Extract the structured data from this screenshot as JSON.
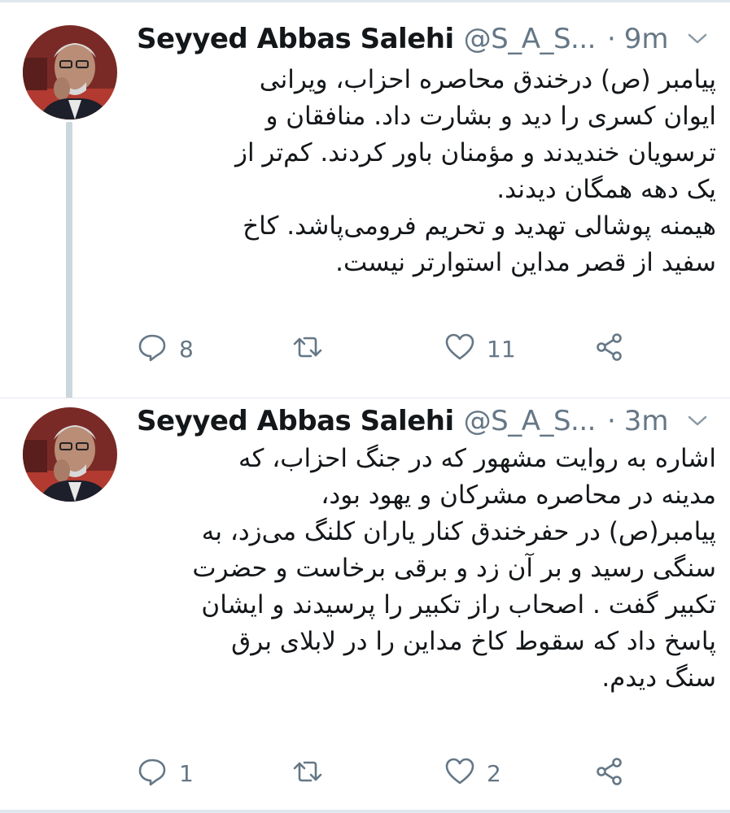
{
  "colors": {
    "text": "#14171a",
    "secondary": "#657786",
    "thread_line": "#ccd6dd",
    "divider": "#e1e8ed"
  },
  "icons": {
    "reply": "reply-icon",
    "retweet": "retweet-icon",
    "like": "heart-icon",
    "share": "share-icon",
    "caret": "chevron-down-icon"
  },
  "tweets": [
    {
      "author_name": "Seyyed Abbas Salehi",
      "handle": "@S_A_S...",
      "separator": "·",
      "time": "9m",
      "lines": [
        "پیامبر (ص) درخندق محاصره احزاب، ویرانی",
        "ایوان کسری  را دید و بشارت داد. منافقان و",
        "ترسویان خندیدند و مؤمنان باور کردند. کم‌تر از",
        "یک دهه همگان دیدند.",
        " هیمنه پوشالی تهدید و تحریم فرومی‌پاشد. کاخ",
        "سفید از قصر مداین استوارتر نیست."
      ],
      "reply_count": "8",
      "retweet_count": "",
      "like_count": "11"
    },
    {
      "author_name": "Seyyed Abbas Salehi",
      "handle": "@S_A_S...",
      "separator": "·",
      "time": "3m",
      "lines": [
        "اشاره به روایت مشهور که در جنگ احزاب، که",
        "مدینه در محاصره مشرکان و یهود بود،",
        "پیامبر(ص) در حفرخندق کنار یاران کلنگ می‌زد، به",
        "سنگی رسید و بر آن زد و برقی برخاست و حضرت",
        "تکبیر گفت . اصحاب راز تکبیر را پرسیدند و ایشان",
        "پاسخ داد که سقوط کاخ مداین را در لابلای برق",
        "سنگ دیدم."
      ],
      "reply_count": "1",
      "retweet_count": "",
      "like_count": "2"
    }
  ]
}
